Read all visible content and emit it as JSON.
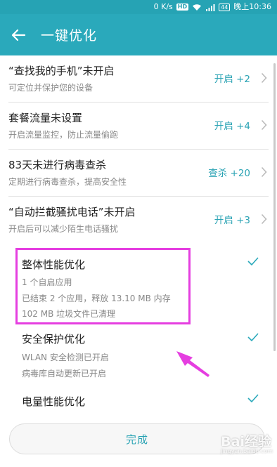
{
  "status_bar": {
    "speed": "0 K/s",
    "hd": "HD",
    "battery": "44",
    "time": "晚上10:36"
  },
  "header": {
    "title": "一键优化",
    "back_icon": "arrow-left-icon"
  },
  "tasks": [
    {
      "title": "“查找我的手机”未开启",
      "subtitle": "可定位并保护您的设备",
      "action": "开启 +2"
    },
    {
      "title": "套餐流量未设置",
      "subtitle": "开启流量监控，防止流量偷跑",
      "action": "开启 +4"
    },
    {
      "title": "83天未进行病毒查杀",
      "subtitle": "定期进行病毒查杀，提高安全性",
      "action": "查杀 +20"
    },
    {
      "title": "“自动拦截骚扰电话”未开启",
      "subtitle": "开启后可以减少陌生电话骚扰",
      "action": "开启 +3"
    }
  ],
  "optimized": [
    {
      "title": "整体性能优化",
      "lines": [
        "1 个自启应用",
        "已结束 2 个应用，释放 13.10 MB 内存",
        "102 MB 垃圾文件已清理"
      ]
    },
    {
      "title": "安全保护优化",
      "lines": [
        "WLAN 安全检测已开启",
        "病毒库自动更新已开启"
      ]
    },
    {
      "title": "电量性能优化",
      "lines": []
    }
  ],
  "done_label": "完成",
  "watermark": {
    "main": "Bai经验",
    "sub": "jingyan.baidu.com"
  },
  "colors": {
    "accent": "#2aa9bb",
    "highlight": "#e53ee0"
  }
}
